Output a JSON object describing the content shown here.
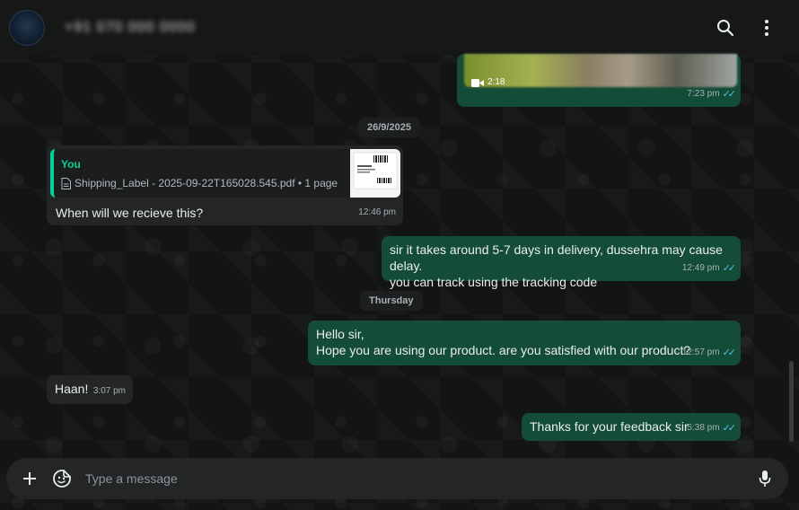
{
  "header": {
    "avatar_text": "",
    "contact_name": "+91 070 000 0000",
    "search_icon": "search-icon",
    "menu_icon": "kebab-menu-icon"
  },
  "messages": [
    {
      "kind": "video",
      "direction": "out",
      "duration": "2:18",
      "time": "7:23 pm",
      "status": "read"
    },
    {
      "kind": "date",
      "text": "26/9/2025"
    },
    {
      "kind": "reply",
      "direction": "in",
      "quote_sender": "You",
      "quote_file": "Shipping_Label - 2025-09-22T165028.545.pdf • 1 page",
      "text": "When will we recieve this?",
      "time": "12:46 pm"
    },
    {
      "kind": "text",
      "direction": "out",
      "line1": "sir it takes around 5-7 days in delivery, dussehra may cause delay.",
      "line2": "you can track using the tracking code",
      "time": "12:49 pm",
      "status": "read"
    },
    {
      "kind": "date",
      "text": "Thursday"
    },
    {
      "kind": "text",
      "direction": "out",
      "line1": "Hello sir,",
      "line2": "Hope you are using our product. are you satisfied with our product?",
      "time": "12:57 pm",
      "status": "read"
    },
    {
      "kind": "text",
      "direction": "in",
      "text": "Haan!",
      "time": "3:07 pm"
    },
    {
      "kind": "text",
      "direction": "out",
      "text": "Thanks for your feedback sir",
      "time": "5:38 pm",
      "status": "read"
    }
  ],
  "composer": {
    "placeholder": "Type a message",
    "attach_icon": "plus-icon",
    "sticker_icon": "sticker-icon",
    "mic_icon": "microphone-icon"
  },
  "colors": {
    "outgoing_bubble": "#144d37",
    "incoming_bubble": "#242626",
    "accent_green": "#06cf9c",
    "read_ticks": "#53bdeb"
  }
}
